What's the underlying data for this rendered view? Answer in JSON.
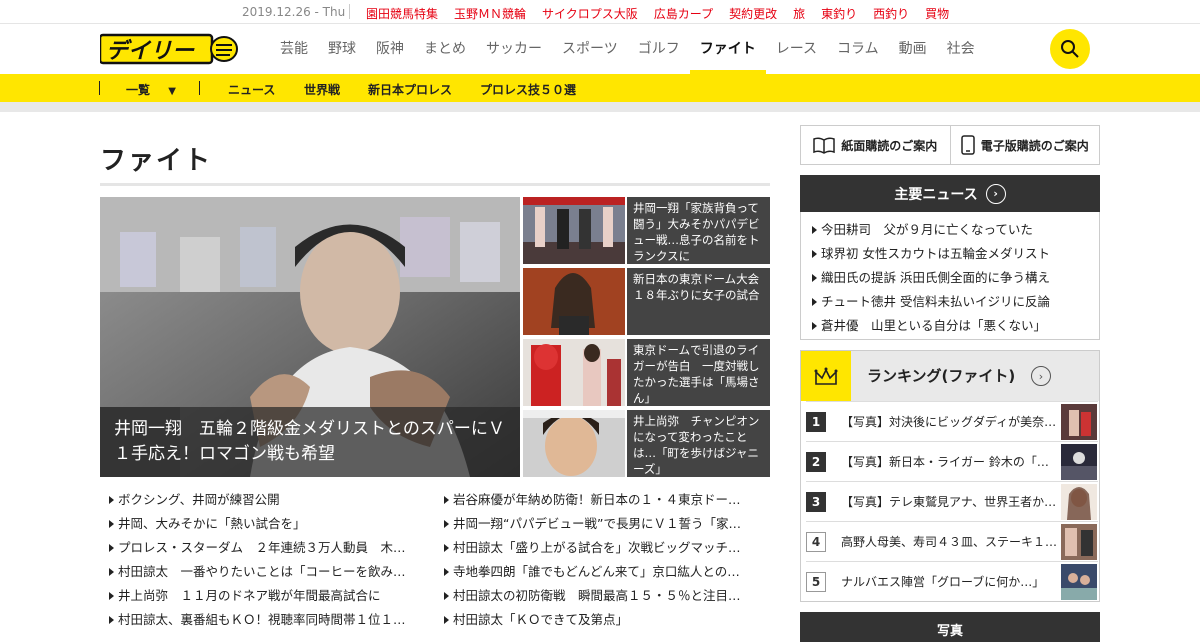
{
  "topbar": {
    "date": "2019.12.26 - Thu",
    "links": [
      "園田競馬特集",
      "玉野ＭＮ競輪",
      "サイクロプス大阪",
      "広島カープ",
      "契約更改",
      "旅",
      "東釣り",
      "西釣り",
      "買物"
    ]
  },
  "header": {
    "logo_text": "デイリー",
    "nav": [
      "芸能",
      "野球",
      "阪神",
      "まとめ",
      "サッカー",
      "スポーツ",
      "ゴルフ",
      "ファイト",
      "レース",
      "コラム",
      "動画",
      "社会"
    ],
    "active_nav": "ファイト"
  },
  "subnav": {
    "menu_label": "一覧",
    "items": [
      "ニュース",
      "世界戦",
      "新日本プロレス",
      "プロレス技５０選"
    ]
  },
  "page_title": "ファイト",
  "hero": {
    "caption": "井岡一翔　五輪２階級金メダリストとのスパーにＶ１手応え！ロマゴン戦も希望"
  },
  "side_news": [
    "井岡一翔「家族背負って闘う」大みそかパパデビュー戦…息子の名前をトランクスに",
    "新日本の東京ドーム大会　１８年ぶりに女子の試合",
    "東京ドームで引退のライガーが告白　一度対戦したかった選手は「馬場さん」",
    "井上尚弥　チャンピオンになって変わったことは…「町を歩けばジャニーズ」"
  ],
  "list_left": [
    "ボクシング、井岡が練習公開",
    "井岡、大みそかに「熱い試合を」",
    "プロレス・スターダム　２年連続３万人動員　木…",
    "村田諒太　一番やりたいことは「コーヒーを飲み…",
    "井上尚弥　１１月のドネア戦が年間最高試合に",
    "村田諒太、裏番組もＫＯ！視聴率同時間帯１位１…"
  ],
  "list_right": [
    "岩谷麻優が年納め防衛！新日本の１・４東京ドー…",
    "井岡一翔“パパデビュー戦”で長男にＶ１誓う「家…",
    "村田諒太「盛り上がる試合を」次戦ビッグマッチ…",
    "寺地拳四朗「誰でもどんどん来て」京口紘人との…",
    "村田諒太の初防衛戦　瞬間最高１５・５％と注目…",
    "村田諒太「ＫＯできて及第点」"
  ],
  "subscription": {
    "paper": "紙面購読のご案内",
    "digital": "電子版購読のご案内"
  },
  "major_news": {
    "title": "主要ニュース",
    "items": [
      "今田耕司　父が９月に亡くなっていた",
      "球界初 女性スカウトは五輪金メダリスト",
      "織田氏の提訴 浜田氏側全面的に争う構え",
      "チュート徳井 受信料未払いイジリに反論",
      "蒼井優　山里といる自分は「悪くない」"
    ]
  },
  "ranking": {
    "title": "ランキング(ファイト)",
    "items": [
      {
        "rank": "1",
        "text": "【写真】対決後にビッグダディが美奈…"
      },
      {
        "rank": "2",
        "text": "【写真】新日本・ライガー 鈴木の「…"
      },
      {
        "rank": "3",
        "text": "【写真】テレ東鷲見アナ、世界王者か…"
      },
      {
        "rank": "4",
        "text": "高野人母美、寿司４３皿、ステーキ１…"
      },
      {
        "rank": "5",
        "text": "ナルバエス陣営「グローブに何か…」"
      }
    ]
  },
  "photo_section_title": "写真",
  "colors": {
    "brand_yellow": "#ffe600",
    "link_red": "#e60012",
    "dark": "#333333"
  }
}
